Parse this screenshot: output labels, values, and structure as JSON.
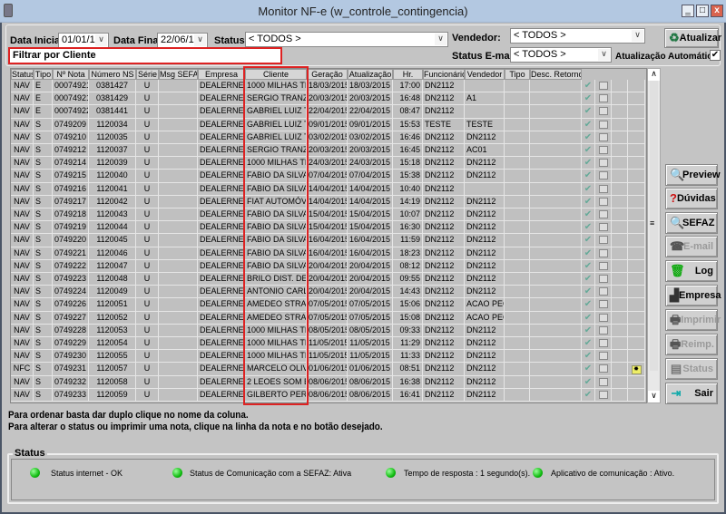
{
  "window": {
    "title": "Monitor NF-e (w_controle_contingencia)",
    "minimize": "‗",
    "maximize": "□",
    "close": "x"
  },
  "filters": {
    "data_inicial_label": "Data Inicial:",
    "data_inicial": "01/01/15",
    "data_final_label": "Data Final:",
    "data_final": "22/06/15",
    "status_label": "Status:",
    "status": "< TODOS >",
    "vendedor_label": "Vendedor:",
    "vendedor": "< TODOS >",
    "status_email_label": "Status E-mail:",
    "status_email": "< TODOS >",
    "auto_update_label": "Atualização Automática",
    "auto_update_checked": true,
    "filter_client": "Filtrar por Cliente"
  },
  "buttons": {
    "atualizar": "Atualizar",
    "preview": "Preview",
    "duvidas": "Dúvidas",
    "sefaz": "SEFAZ",
    "email": "E-mail",
    "log": "Log",
    "empresa": "Empresa",
    "imprimir": "Imprimir",
    "reimp": "Reimp.",
    "status": "Status",
    "sair": "Sair"
  },
  "table": {
    "columns": [
      "Status",
      "Tipo",
      "Nº Nota",
      "Número NS",
      "Série",
      "Msg SEFAZ",
      "Empresa",
      "Cliente",
      "Geração",
      "Atualização",
      "Hr.",
      "Funcionário",
      "Vendedor",
      "Tipo",
      "Desc. Retorno"
    ],
    "rows": [
      [
        "NAV",
        "E",
        "000749211",
        "0381427",
        "U",
        "",
        "DEALERNET",
        "1000 MILHAS TRAS",
        "18/03/2015",
        "18/03/2015",
        "17:00",
        "DN2112",
        "",
        "",
        ""
      ],
      [
        "NAV",
        "E",
        "000749213",
        "0381429",
        "U",
        "",
        "DEALERNET",
        "SERGIO TRANZILO",
        "20/03/2015",
        "20/03/2015",
        "16:48",
        "DN2112",
        "A1",
        "",
        ""
      ],
      [
        "NAV",
        "E",
        "000749225",
        "0381441",
        "U",
        "",
        "DEALERNET",
        "GABRIEL LUIZ TEI",
        "22/04/2015",
        "22/04/2015",
        "08:47",
        "DN2112",
        "",
        "",
        ""
      ],
      [
        "NAV",
        "S",
        "0749209",
        "1120034",
        "U",
        "",
        "DEALERNET",
        "GABRIEL LUIZ TEI",
        "09/01/2015",
        "09/01/2015",
        "15:53",
        "TESTE",
        "TESTE",
        "",
        ""
      ],
      [
        "NAV",
        "S",
        "0749210",
        "1120035",
        "U",
        "",
        "DEALERNET",
        "GABRIEL LUIZ TEI",
        "03/02/2015",
        "03/02/2015",
        "16:46",
        "DN2112",
        "DN2112",
        "",
        ""
      ],
      [
        "NAV",
        "S",
        "0749212",
        "1120037",
        "U",
        "",
        "DEALERNET",
        "SERGIO TRANZILO",
        "20/03/2015",
        "20/03/2015",
        "16:45",
        "DN2112",
        "AC01",
        "",
        ""
      ],
      [
        "NAV",
        "S",
        "0749214",
        "1120039",
        "U",
        "",
        "DEALERNET",
        "1000 MILHAS TRAS",
        "24/03/2015",
        "24/03/2015",
        "15:18",
        "DN2112",
        "DN2112",
        "",
        ""
      ],
      [
        "NAV",
        "S",
        "0749215",
        "1120040",
        "U",
        "",
        "DEALERNET",
        "FABIO DA SILVA",
        "07/04/2015",
        "07/04/2015",
        "15:38",
        "DN2112",
        "DN2112",
        "",
        ""
      ],
      [
        "NAV",
        "S",
        "0749216",
        "1120041",
        "U",
        "",
        "DEALERNET",
        "FABIO DA SILVA",
        "14/04/2015",
        "14/04/2015",
        "10:40",
        "DN2112",
        "",
        "",
        ""
      ],
      [
        "NAV",
        "S",
        "0749217",
        "1120042",
        "U",
        "",
        "DEALERNET",
        "FIAT AUTOMÓVEIS",
        "14/04/2015",
        "14/04/2015",
        "14:19",
        "DN2112",
        "DN2112",
        "",
        ""
      ],
      [
        "NAV",
        "S",
        "0749218",
        "1120043",
        "U",
        "",
        "DEALERNET",
        "FABIO DA SILVA",
        "15/04/2015",
        "15/04/2015",
        "10:07",
        "DN2112",
        "DN2112",
        "",
        ""
      ],
      [
        "NAV",
        "S",
        "0749219",
        "1120044",
        "U",
        "",
        "DEALERNET",
        "FABIO DA SILVA",
        "15/04/2015",
        "15/04/2015",
        "16:30",
        "DN2112",
        "DN2112",
        "",
        ""
      ],
      [
        "NAV",
        "S",
        "0749220",
        "1120045",
        "U",
        "",
        "DEALERNET",
        "FABIO DA SILVA",
        "16/04/2015",
        "16/04/2015",
        "11:59",
        "DN2112",
        "DN2112",
        "",
        ""
      ],
      [
        "NAV",
        "S",
        "0749221",
        "1120046",
        "U",
        "",
        "DEALERNET",
        "FABIO DA SILVA",
        "16/04/2015",
        "16/04/2015",
        "18:23",
        "DN2112",
        "DN2112",
        "",
        ""
      ],
      [
        "NAV",
        "S",
        "0749222",
        "1120047",
        "U",
        "",
        "DEALERNET",
        "FABIO DA SILVA",
        "20/04/2015",
        "20/04/2015",
        "08:12",
        "DN2112",
        "DN2112",
        "",
        ""
      ],
      [
        "NAV",
        "S",
        "0749223",
        "1120048",
        "U",
        "",
        "DEALERNET",
        "BRILO DIST. DE VE",
        "20/04/2015",
        "20/04/2015",
        "09:55",
        "DN2112",
        "DN2112",
        "",
        ""
      ],
      [
        "NAV",
        "S",
        "0749224",
        "1120049",
        "U",
        "",
        "DEALERNET",
        "ANTONIO CARLOS",
        "20/04/2015",
        "20/04/2015",
        "14:43",
        "DN2112",
        "DN2112",
        "",
        ""
      ],
      [
        "NAV",
        "S",
        "0749226",
        "1120051",
        "U",
        "",
        "DEALERNET",
        "AMEDEO STRAZZA",
        "07/05/2015",
        "07/05/2015",
        "15:06",
        "DN2112",
        "ACAO PECA",
        "",
        ""
      ],
      [
        "NAV",
        "S",
        "0749227",
        "1120052",
        "U",
        "",
        "DEALERNET",
        "AMEDEO STRAZZA",
        "07/05/2015",
        "07/05/2015",
        "15:08",
        "DN2112",
        "ACAO PECA",
        "",
        ""
      ],
      [
        "NAV",
        "S",
        "0749228",
        "1120053",
        "U",
        "",
        "DEALERNET",
        "1000 MILHAS TRAS",
        "08/05/2015",
        "08/05/2015",
        "09:33",
        "DN2112",
        "DN2112",
        "",
        ""
      ],
      [
        "NAV",
        "S",
        "0749229",
        "1120054",
        "U",
        "",
        "DEALERNET",
        "1000 MILHAS TRAS",
        "11/05/2015",
        "11/05/2015",
        "11:29",
        "DN2112",
        "DN2112",
        "",
        ""
      ],
      [
        "NAV",
        "S",
        "0749230",
        "1120055",
        "U",
        "",
        "DEALERNET",
        "1000 MILHAS TRAS",
        "11/05/2015",
        "11/05/2015",
        "11:33",
        "DN2112",
        "DN2112",
        "",
        ""
      ],
      [
        "NFC",
        "S",
        "0749231",
        "1120057",
        "U",
        "",
        "DEALERNET",
        "MARCELO OLIVEIR",
        "01/06/2015",
        "01/06/2015",
        "08:51",
        "DN2112",
        "DN2112",
        "",
        ""
      ],
      [
        "NAV",
        "S",
        "0749232",
        "1120058",
        "U",
        "",
        "DEALERNET",
        "2 LEOES SOM E AC",
        "08/06/2015",
        "08/06/2015",
        "16:38",
        "DN2112",
        "DN2112",
        "",
        ""
      ],
      [
        "NAV",
        "S",
        "0749233",
        "1120059",
        "U",
        "",
        "DEALERNET",
        "GILBERTO PEREIR",
        "08/06/2015",
        "08/06/2015",
        "16:41",
        "DN2112",
        "DN2112",
        "",
        ""
      ]
    ],
    "row_icons": [
      "check-icon",
      "document-icon"
    ],
    "flagged_row": 22
  },
  "notes": [
    "Para ordenar basta dar duplo clique no nome da coluna.",
    "Para alterar o status ou imprimir uma nota, clique na linha da nota e no botão desejado."
  ],
  "status": {
    "title": "Status",
    "items": [
      "Status internet - OK",
      "Status de Comunicação com a SEFAZ: Ativa",
      "Tempo de resposta : 1 segundo(s).",
      "Aplicativo de comunicação : Ativo."
    ],
    "led_color": "#22bb22"
  },
  "colors": {
    "highlight": "#dd2222",
    "titlebar": "#b3c8e1"
  }
}
